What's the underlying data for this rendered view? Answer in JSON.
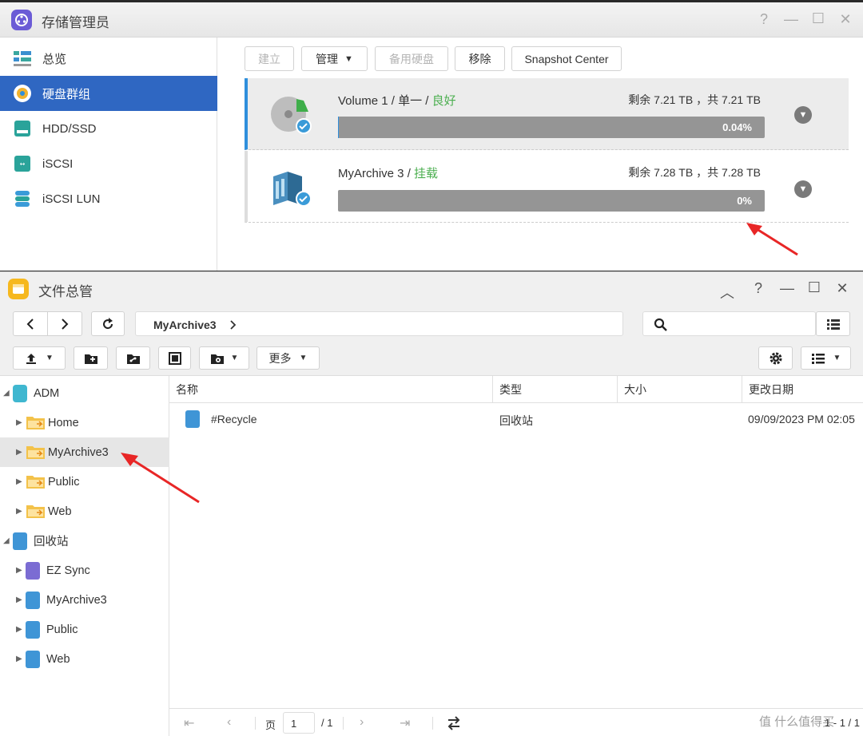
{
  "storage": {
    "title": "存储管理员",
    "window_controls": [
      "?",
      "—",
      "☐",
      "✕"
    ],
    "nav": [
      {
        "label": "总览",
        "icon": "overview-icon"
      },
      {
        "label": "硬盘群组",
        "icon": "disk-group-icon"
      },
      {
        "label": "HDD/SSD",
        "icon": "hdd-icon"
      },
      {
        "label": "iSCSI",
        "icon": "iscsi-icon"
      },
      {
        "label": "iSCSI LUN",
        "icon": "iscsi-lun-icon"
      }
    ],
    "toolbar": {
      "create": "建立",
      "manage": "管理",
      "spare": "备用硬盘",
      "remove": "移除",
      "snapshot": "Snapshot Center"
    },
    "volumes": [
      {
        "name": "Volume 1",
        "sep": " / ",
        "type": "单一",
        "sep2": " / ",
        "status": "良好",
        "space": "剩余 7.21 TB ，共 7.21 TB",
        "usage_label": "0.04%",
        "usage_fraction": 0.0004
      },
      {
        "name": "MyArchive 3",
        "sep": " / ",
        "status": "挂载",
        "space": "剩余 7.28 TB ，共 7.28 TB",
        "usage_label": "0%",
        "usage_fraction": 0
      }
    ]
  },
  "explorer": {
    "title": "文件总管",
    "window_controls": [
      "︿",
      "?",
      "—",
      "☐",
      "✕"
    ],
    "breadcrumb": "MyArchive3",
    "more_label": "更多",
    "tree": [
      {
        "label": "ADM",
        "level": 0
      },
      {
        "label": "Home",
        "level": 1
      },
      {
        "label": "MyArchive3",
        "level": 1,
        "selected": true
      },
      {
        "label": "Public",
        "level": 1
      },
      {
        "label": "Web",
        "level": 1
      },
      {
        "label": "回收站",
        "level": 0
      },
      {
        "label": "EZ Sync",
        "level": 1
      },
      {
        "label": "MyArchive3",
        "level": 1
      },
      {
        "label": "Public",
        "level": 1
      },
      {
        "label": "Web",
        "level": 1
      }
    ],
    "columns": [
      "名称",
      "类型",
      "大小",
      "更改日期"
    ],
    "rows": [
      {
        "name": "#Recycle",
        "type": "回收站",
        "size": "",
        "date": "09/09/2023 PM 02:05"
      }
    ],
    "pager": {
      "page_label": "页",
      "page": "1",
      "total": "/ 1",
      "range": "1 - 1 / 1"
    }
  },
  "watermark": "值 什么值得买"
}
